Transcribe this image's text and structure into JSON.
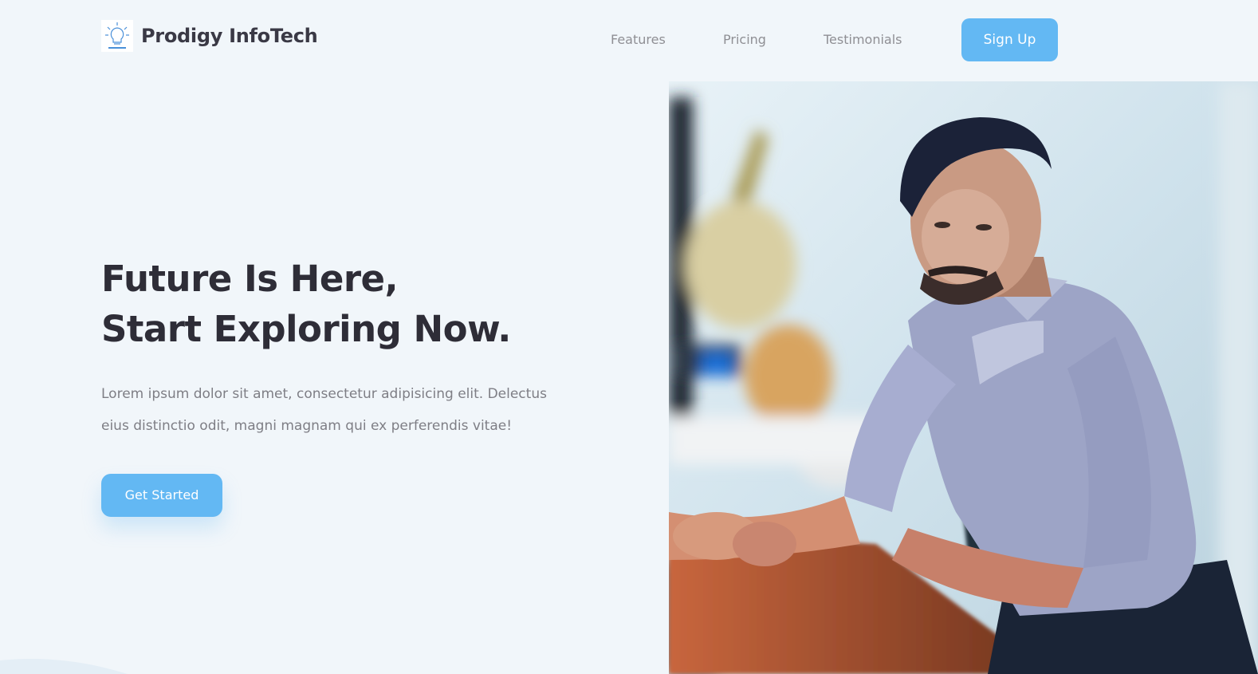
{
  "header": {
    "logo_icon": "lightbulb-icon",
    "brand": "Prodigy InfoTech",
    "nav": {
      "features": "Features",
      "pricing": "Pricing",
      "testimonials": "Testimonials"
    },
    "signup_label": "Sign Up"
  },
  "hero": {
    "title_line1": "Future Is Here,",
    "title_line2": "Start Exploring Now.",
    "description": "Lorem ipsum dolor sit amet, consectetur adipisicing elit. Delectus eius distinctio odit, magni magnam qui ex perferendis vitae!",
    "cta_label": "Get Started",
    "photo": "person-at-desk-photo"
  },
  "colors": {
    "background": "#f1f6fa",
    "accent": "#63b8f3",
    "heading": "#2e2d37",
    "body_text": "#7e7e85",
    "nav_text": "#8f8f94"
  }
}
